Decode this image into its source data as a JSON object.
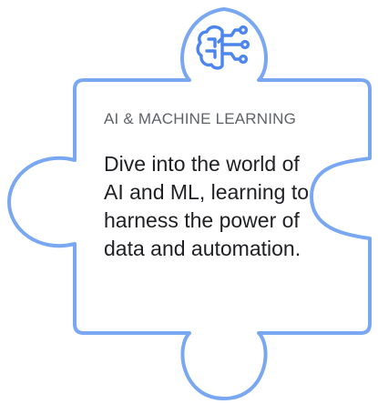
{
  "card": {
    "eyebrow": "AI & MACHINE LEARNING",
    "description": "Dive into the world of AI and ML, learning to harness the power of data and automation.",
    "icon": "brain-circuit-icon"
  },
  "colors": {
    "outline": "#7aa7f2",
    "icon": "#4c85ee",
    "eyebrow_text": "#5f6368",
    "body_text": "#202124"
  }
}
